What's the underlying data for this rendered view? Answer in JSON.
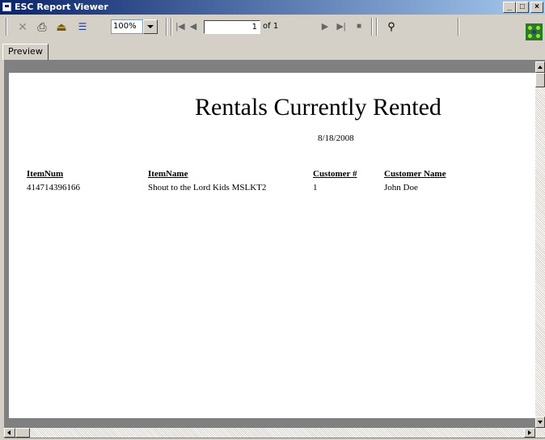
{
  "window": {
    "title": "ESC Report Viewer"
  },
  "toolbar": {
    "zoom_value": "100%",
    "page_current": "1",
    "page_total_label": "of 1"
  },
  "tabs": [
    {
      "label": "Preview"
    }
  ],
  "report": {
    "title": "Rentals Currently Rented",
    "date": "8/18/2008",
    "columns": [
      "ItemNum",
      "ItemName",
      "Customer #",
      "Customer Name"
    ],
    "rows": [
      [
        "414714396166",
        "Shout to the Lord Kids MSLKT2",
        "1",
        "John Doe"
      ]
    ]
  },
  "colors": {
    "titlebar_start": "#0a246a",
    "titlebar_end": "#a6caf0",
    "chrome": "#d4d0c8",
    "viewer_bg": "#808080"
  }
}
